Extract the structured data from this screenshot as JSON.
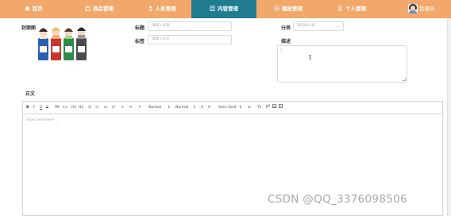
{
  "nav": {
    "items": [
      {
        "label": "首页",
        "icon": "home-icon",
        "active": false
      },
      {
        "label": "商品管理",
        "icon": "goods-icon",
        "active": false
      },
      {
        "label": "人员管理",
        "icon": "users-icon",
        "active": false
      },
      {
        "label": "内容管理",
        "icon": "content-icon",
        "active": true
      },
      {
        "label": "播放管理",
        "icon": "play-icon",
        "active": false
      },
      {
        "label": "个人管理",
        "icon": "profile-icon",
        "active": false
      }
    ],
    "user_name": "管理员",
    "colors": {
      "bar": "#f2a86b",
      "active": "#1f7c91"
    }
  },
  "form": {
    "cover_label": "封面图",
    "title_label": "标题",
    "title_placeholder": "请输入标题",
    "tag_label": "标签",
    "tag_placeholder": "请输入标签",
    "category_label": "分类",
    "category_placeholder": "请选择分类",
    "description_label": "描述",
    "description_value": "1",
    "content_label": "正文"
  },
  "editor": {
    "toolbar": {
      "bold": "B",
      "italic": "I",
      "underline": "U",
      "strike": "S",
      "quote": "99",
      "code": "<>",
      "h1": "H1",
      "h2": "H2",
      "ordered_list": "☰",
      "bullet_list": "☷",
      "subscript": "x₂",
      "superscript": "x²",
      "indent_left": "⇤",
      "indent_right": "⇥",
      "direction": "↱",
      "size_value": "Normal",
      "header_value": "Normal",
      "font_color": "A",
      "background_color": "A",
      "font_value": "Sans Serif",
      "align": "≡",
      "clean": "Tx",
      "link": "🔗",
      "image": "▣",
      "video": "▤"
    },
    "placeholder": "Insert text here ..."
  },
  "watermark": "CSDN @QQ_3376098506"
}
